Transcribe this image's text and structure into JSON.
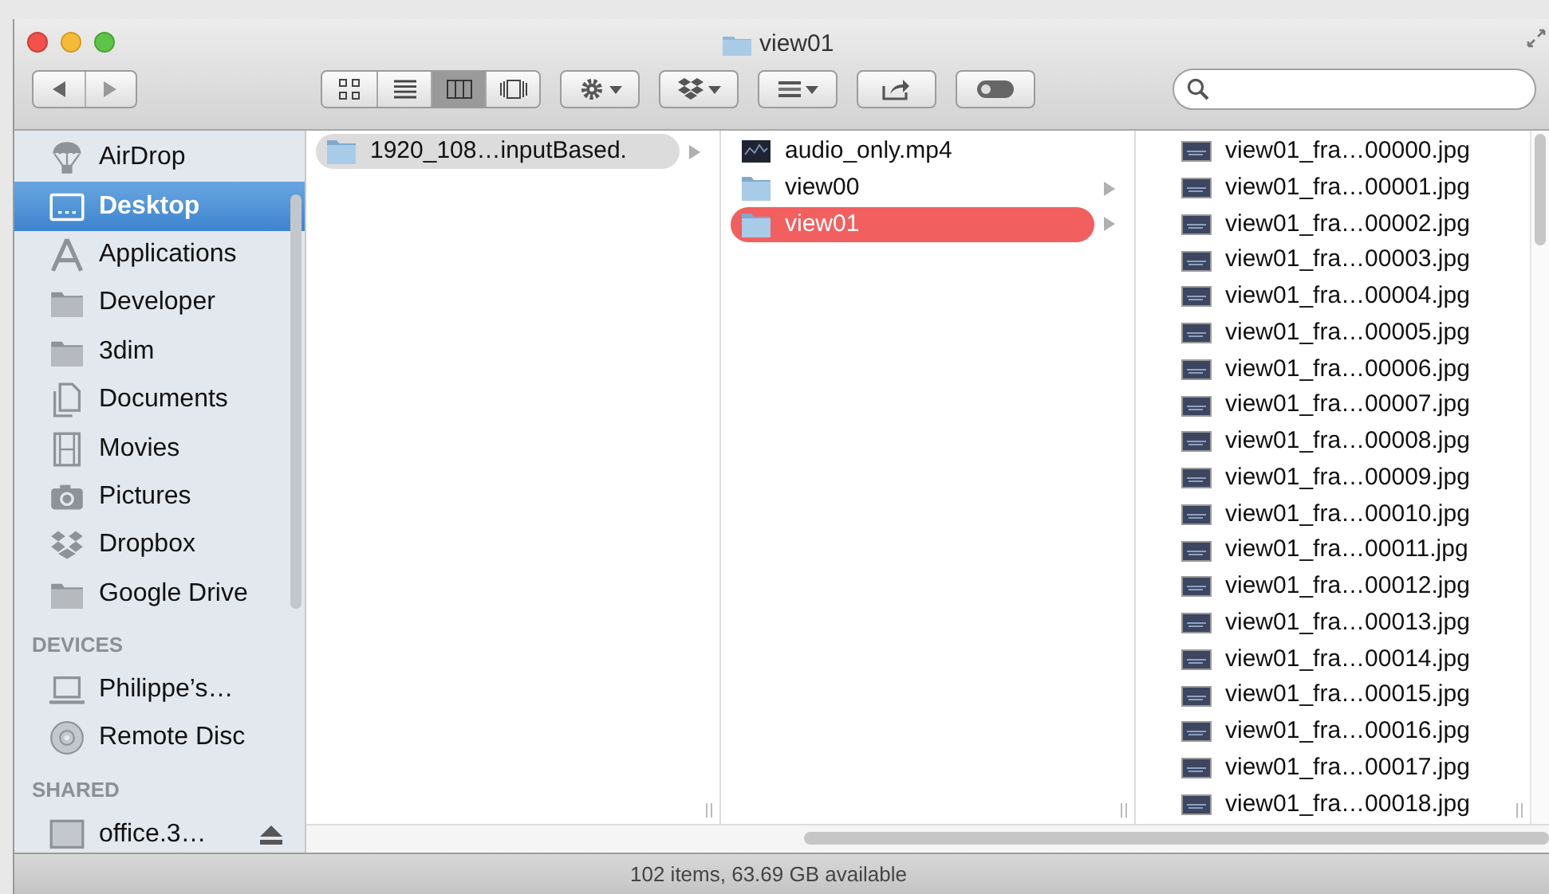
{
  "window": {
    "title": "view01"
  },
  "toolbar": {
    "view_modes": [
      {
        "kind": "icons",
        "selected": false
      },
      {
        "kind": "list",
        "selected": false
      },
      {
        "kind": "columns",
        "selected": true
      },
      {
        "kind": "coverflow",
        "selected": false
      }
    ]
  },
  "sidebar": {
    "sections": [
      {
        "items": [
          {
            "label": "AirDrop",
            "kind": "airdrop",
            "selected": false
          },
          {
            "label": "Desktop",
            "kind": "desktop",
            "selected": true
          },
          {
            "label": "Applications",
            "kind": "applications",
            "selected": false
          },
          {
            "label": "Developer",
            "kind": "folder",
            "selected": false
          },
          {
            "label": "3dim",
            "kind": "folder",
            "selected": false
          },
          {
            "label": "Documents",
            "kind": "documents",
            "selected": false
          },
          {
            "label": "Movies",
            "kind": "movies",
            "selected": false
          },
          {
            "label": "Pictures",
            "kind": "pictures",
            "selected": false
          },
          {
            "label": "Dropbox",
            "kind": "dropbox",
            "selected": false
          },
          {
            "label": "Google Drive",
            "kind": "folder",
            "selected": false
          }
        ]
      },
      {
        "heading": "DEVICES",
        "items": [
          {
            "label": "Philippe’s…",
            "kind": "laptop",
            "selected": false
          },
          {
            "label": "Remote Disc",
            "kind": "disc",
            "selected": false
          }
        ]
      },
      {
        "heading": "SHARED",
        "items": [
          {
            "label": "office.3…",
            "kind": "server",
            "selected": false,
            "ejectable": true
          }
        ]
      }
    ]
  },
  "columns": [
    {
      "entries": [
        {
          "name": "1920_108…inputBased.",
          "kind": "folder",
          "selected": true
        }
      ]
    },
    {
      "entries": [
        {
          "name": "audio_only.mp4",
          "kind": "video",
          "selected": false
        },
        {
          "name": "view00",
          "kind": "folder",
          "selected": false
        },
        {
          "name": "view01",
          "kind": "folder",
          "selected": true,
          "color": "#f25f5f"
        }
      ]
    },
    {
      "entries": [
        {
          "name": "view01_fra…00000.jpg",
          "kind": "image",
          "selected": false
        },
        {
          "name": "view01_fra…00001.jpg",
          "kind": "image",
          "selected": false
        },
        {
          "name": "view01_fra…00002.jpg",
          "kind": "image",
          "selected": false
        },
        {
          "name": "view01_fra…00003.jpg",
          "kind": "image",
          "selected": false
        },
        {
          "name": "view01_fra…00004.jpg",
          "kind": "image",
          "selected": false
        },
        {
          "name": "view01_fra…00005.jpg",
          "kind": "image",
          "selected": false
        },
        {
          "name": "view01_fra…00006.jpg",
          "kind": "image",
          "selected": false
        },
        {
          "name": "view01_fra…00007.jpg",
          "kind": "image",
          "selected": false
        },
        {
          "name": "view01_fra…00008.jpg",
          "kind": "image",
          "selected": false
        },
        {
          "name": "view01_fra…00009.jpg",
          "kind": "image",
          "selected": false
        },
        {
          "name": "view01_fra…00010.jpg",
          "kind": "image",
          "selected": false
        },
        {
          "name": "view01_fra…00011.jpg",
          "kind": "image",
          "selected": false
        },
        {
          "name": "view01_fra…00012.jpg",
          "kind": "image",
          "selected": false
        },
        {
          "name": "view01_fra…00013.jpg",
          "kind": "image",
          "selected": false
        },
        {
          "name": "view01_fra…00014.jpg",
          "kind": "image",
          "selected": false
        },
        {
          "name": "view01_fra…00015.jpg",
          "kind": "image",
          "selected": false
        },
        {
          "name": "view01_fra…00016.jpg",
          "kind": "image",
          "selected": false
        },
        {
          "name": "view01_fra…00017.jpg",
          "kind": "image",
          "selected": false
        },
        {
          "name": "view01_fra…00018.jpg",
          "kind": "image",
          "selected": false
        }
      ]
    }
  ],
  "status_bar": "102 items, 63.69 GB available"
}
